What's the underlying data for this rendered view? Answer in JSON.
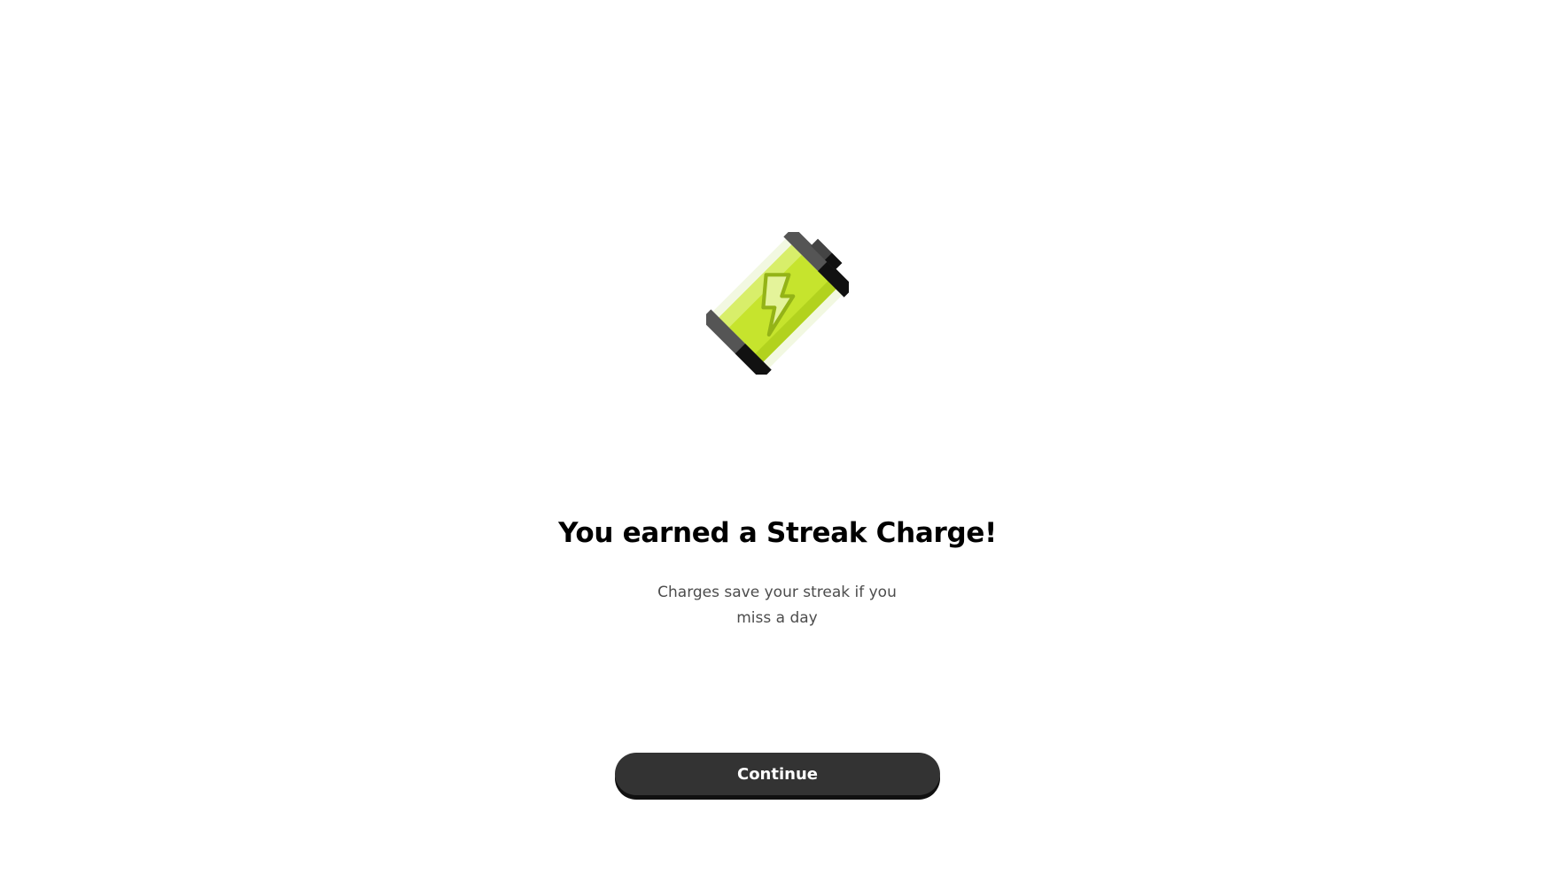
{
  "reward": {
    "icon": "battery-bolt-icon",
    "title": "You earned a Streak Charge!",
    "subtitle_line1": "Charges save your streak if you",
    "subtitle_line2": "miss a day"
  },
  "actions": {
    "continue_label": "Continue"
  },
  "colors": {
    "background": "#ffffff",
    "battery_fill": "#c6e42d",
    "button_bg": "#333333",
    "button_text": "#ffffff"
  }
}
